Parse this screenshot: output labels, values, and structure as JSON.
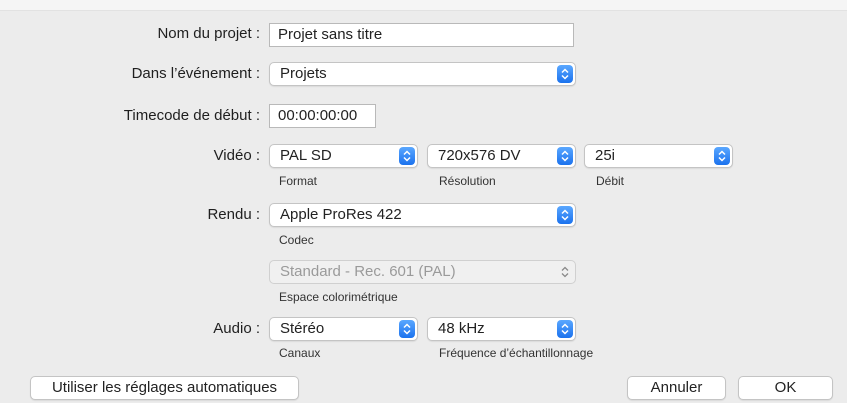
{
  "form": {
    "project_name_label": "Nom du projet :",
    "project_name_value": "Projet sans titre",
    "event_label": "Dans l’événement :",
    "event_value": "Projets",
    "timecode_label": "Timecode de début :",
    "timecode_value": "00:00:00:00",
    "video_label": "Vidéo :",
    "video_format": "PAL SD",
    "video_resolution": "720x576 DV",
    "video_rate": "25i",
    "format_caption": "Format",
    "resolution_caption": "Résolution",
    "rate_caption": "Débit",
    "render_label": "Rendu :",
    "render_codec": "Apple ProRes 422",
    "codec_caption": "Codec",
    "color_space": "Standard - Rec. 601 (PAL)",
    "color_space_caption": "Espace colorimétrique",
    "audio_label": "Audio :",
    "audio_channels": "Stéréo",
    "audio_sample_rate": "48 kHz",
    "channels_caption": "Canaux",
    "sample_rate_caption": "Fréquence d’échantillonnage"
  },
  "buttons": {
    "auto_settings": "Utiliser les réglages automatiques",
    "cancel": "Annuler",
    "ok": "OK"
  },
  "icons": {
    "popup_arrows": "up-down-chevron-icon"
  },
  "colors": {
    "accent": "#1b72ee",
    "background": "#ececec"
  }
}
